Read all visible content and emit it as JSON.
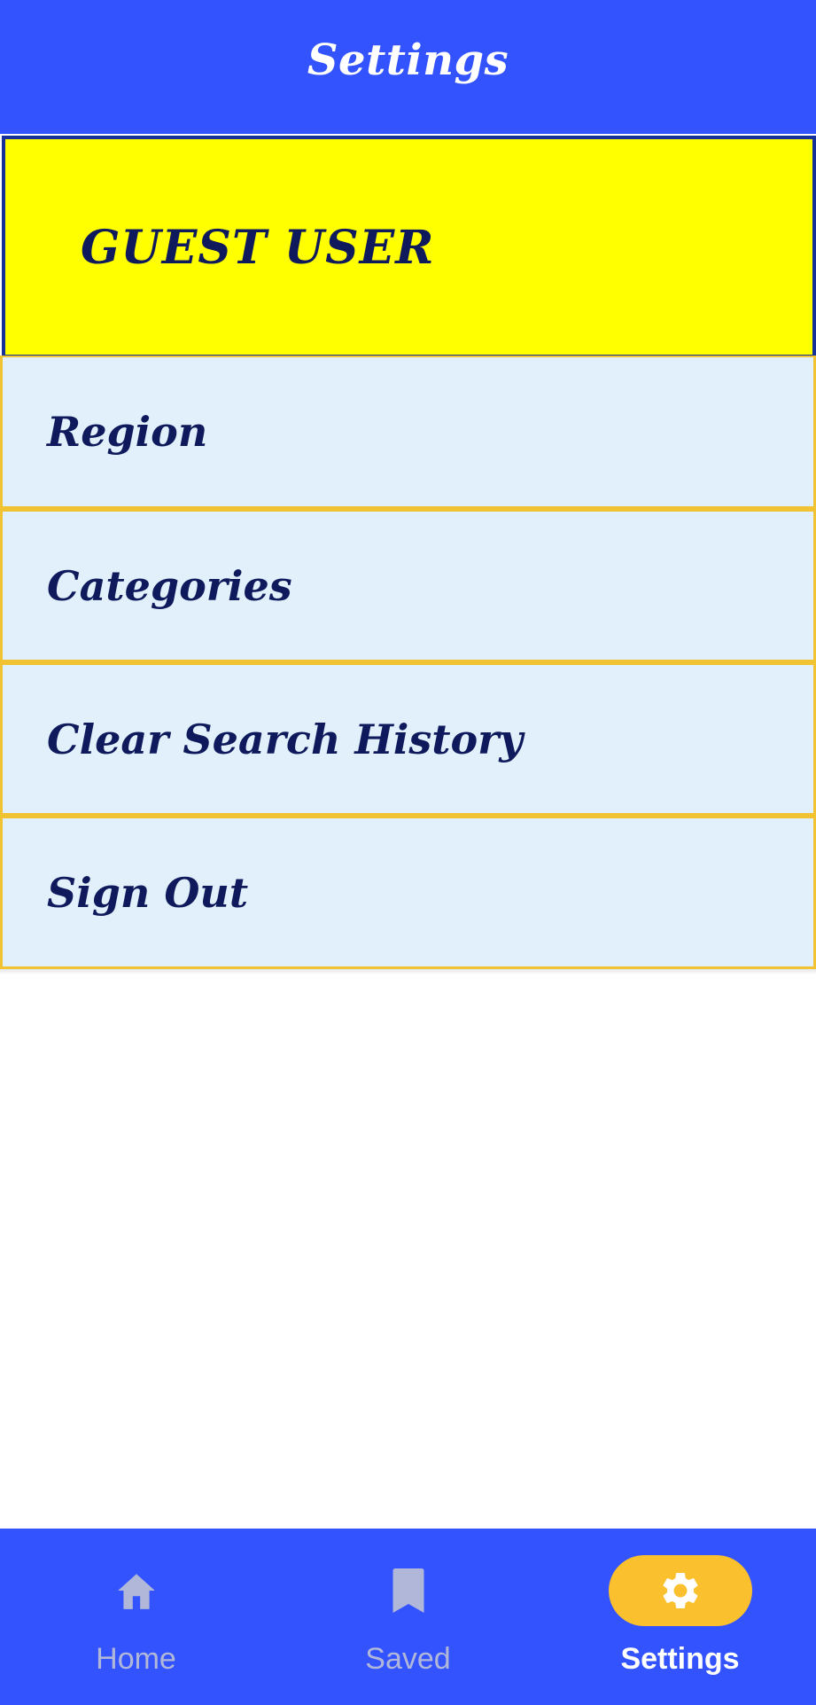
{
  "header": {
    "title": "Settings"
  },
  "user_card": {
    "name": "GUEST USER"
  },
  "settings_items": [
    {
      "label": "Region"
    },
    {
      "label": "Categories"
    },
    {
      "label": "Clear Search History"
    },
    {
      "label": "Sign Out"
    }
  ],
  "bottom_nav": {
    "items": [
      {
        "label": "Home",
        "icon": "home-icon",
        "active": false
      },
      {
        "label": "Saved",
        "icon": "bookmark-icon",
        "active": false
      },
      {
        "label": "Settings",
        "icon": "gear-icon",
        "active": true
      }
    ]
  },
  "colors": {
    "primary": "#3353FE",
    "user_card_bg": "#FFFF00",
    "item_bg": "#E1F0FB",
    "item_border": "#F1C232",
    "text_dark": "#0E1A5C",
    "active_pill": "#FBC02D",
    "inactive_nav": "#B0B7D9"
  }
}
